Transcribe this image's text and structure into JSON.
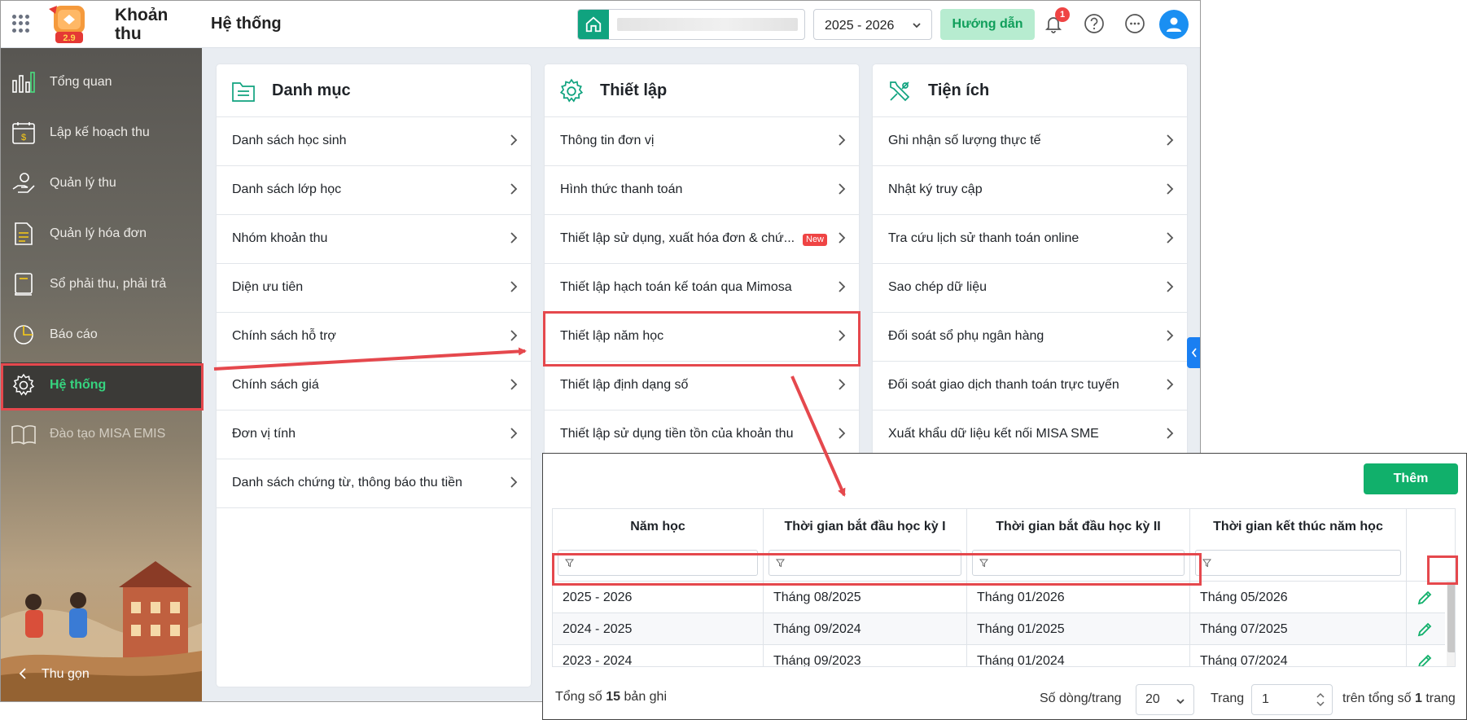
{
  "header": {
    "app_name_line1": "Khoản",
    "app_name_line2": "thu",
    "logo_version": "2.9",
    "page_title": "Hệ thống",
    "school_year": "2025 - 2026",
    "guide_label": "Hướng dẫn",
    "notification_count": "1"
  },
  "sidebar": {
    "items": [
      {
        "label": "Tổng quan",
        "icon": "chart-bars-icon"
      },
      {
        "label": "Lập kế hoạch thu",
        "icon": "calendar-dollar-icon"
      },
      {
        "label": "Quản lý thu",
        "icon": "hand-coin-icon"
      },
      {
        "label": "Quản lý hóa đơn",
        "icon": "invoice-icon"
      },
      {
        "label": "Sổ phải thu, phải trả",
        "icon": "ledger-book-icon"
      },
      {
        "label": "Báo cáo",
        "icon": "pie-chart-icon"
      },
      {
        "label": "Hệ thống",
        "icon": "gear-icon",
        "active": true
      },
      {
        "label": "Đào tạo MISA EMIS",
        "icon": "open-book-icon"
      }
    ],
    "collapse_label": "Thu gọn"
  },
  "cards": {
    "danh_muc": {
      "title": "Danh mục",
      "items": [
        "Danh sách học sinh",
        "Danh sách lớp học",
        "Nhóm khoản thu",
        "Diện ưu tiên",
        "Chính sách hỗ trợ",
        "Chính sách giá",
        "Đơn vị tính",
        "Danh sách chứng từ, thông báo thu tiền"
      ]
    },
    "thiet_lap": {
      "title": "Thiết lập",
      "items": [
        "Thông tin đơn vị",
        "Hình thức thanh toán",
        "Thiết lập sử dụng, xuất hóa đơn & chứ...",
        "Thiết lập hạch toán kế toán qua Mimosa",
        "Thiết lập năm học",
        "Thiết lập định dạng số",
        "Thiết lập sử dụng tiền tồn của khoản thu"
      ],
      "new_badge": "New"
    },
    "tien_ich": {
      "title": "Tiện ích",
      "items": [
        "Ghi nhận số lượng thực tế",
        "Nhật ký truy cập",
        "Tra cứu lịch sử thanh toán online",
        "Sao chép dữ liệu",
        "Đối soát sổ phụ ngân hàng",
        "Đối soát giao dịch thanh toán trực tuyến",
        "Xuất khẩu dữ liệu kết nối MISA SME"
      ]
    }
  },
  "school_year_popup": {
    "add_label": "Thêm",
    "columns": [
      "Năm học",
      "Thời gian bắt đầu học kỳ I",
      "Thời gian bắt đầu học kỳ II",
      "Thời gian kết thúc năm học"
    ],
    "rows": [
      [
        "2025 - 2026",
        "Tháng 08/2025",
        "Tháng 01/2026",
        "Tháng 05/2026"
      ],
      [
        "2024 - 2025",
        "Tháng 09/2024",
        "Tháng 01/2025",
        "Tháng 07/2025"
      ],
      [
        "2023 - 2024",
        "Tháng 09/2023",
        "Tháng 01/2024",
        "Tháng 07/2024"
      ]
    ],
    "footer": {
      "total_prefix": "Tổng số",
      "total_count": "15",
      "total_suffix": "bản ghi",
      "rows_per_page_label": "Số dòng/trang",
      "rows_per_page": "20",
      "page_label": "Trang",
      "page": "1",
      "of_prefix": "trên tổng số",
      "page_count": "1",
      "of_suffix": "trang"
    }
  },
  "colors": {
    "accent_green": "#11b06b",
    "highlight_red": "#e5484d",
    "active_nav_text": "#36d47f",
    "avatar_blue": "#1a8ff2"
  }
}
